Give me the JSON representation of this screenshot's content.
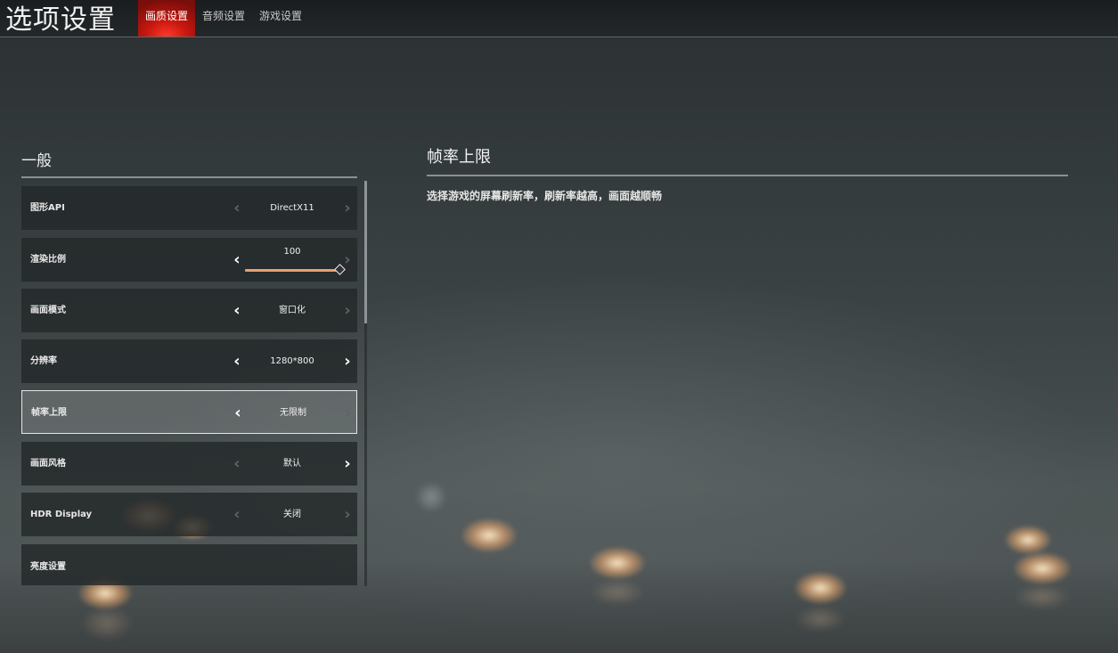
{
  "header": {
    "title": "选项设置",
    "tabs": [
      {
        "label": "画质设置",
        "active": true
      },
      {
        "label": "音频设置",
        "active": false
      },
      {
        "label": "游戏设置",
        "active": false
      }
    ]
  },
  "section": {
    "title": "一般"
  },
  "settings": [
    {
      "label": "图形API",
      "value": "DirectX11",
      "left_enabled": false,
      "right_enabled": false
    },
    {
      "label": "渲染比例",
      "value": "100",
      "left_enabled": true,
      "right_enabled": false,
      "slider_fraction": 1.0
    },
    {
      "label": "画面模式",
      "value": "窗口化",
      "left_enabled": true,
      "right_enabled": false
    },
    {
      "label": "分辨率",
      "value": "1280*800",
      "left_enabled": true,
      "right_enabled": true
    },
    {
      "label": "帧率上限",
      "value": "无限制",
      "left_enabled": true,
      "right_enabled": false,
      "selected": true
    },
    {
      "label": "画面风格",
      "value": "默认",
      "left_enabled": false,
      "right_enabled": true
    },
    {
      "label": "HDR Display",
      "value": "关闭",
      "left_enabled": false,
      "right_enabled": false
    },
    {
      "label": "亮度设置",
      "value": ""
    }
  ],
  "description": {
    "title": "帧率上限",
    "text": "选择游戏的屏幕刷新率，刷新率越高，画面越顺畅"
  },
  "colors": {
    "active_tab": "#c8170f",
    "slider": "#e8a070",
    "selected_border": "#e6e6e6"
  },
  "icons": {
    "left_arrow": "chevron-left-icon",
    "right_arrow": "chevron-right-icon"
  }
}
